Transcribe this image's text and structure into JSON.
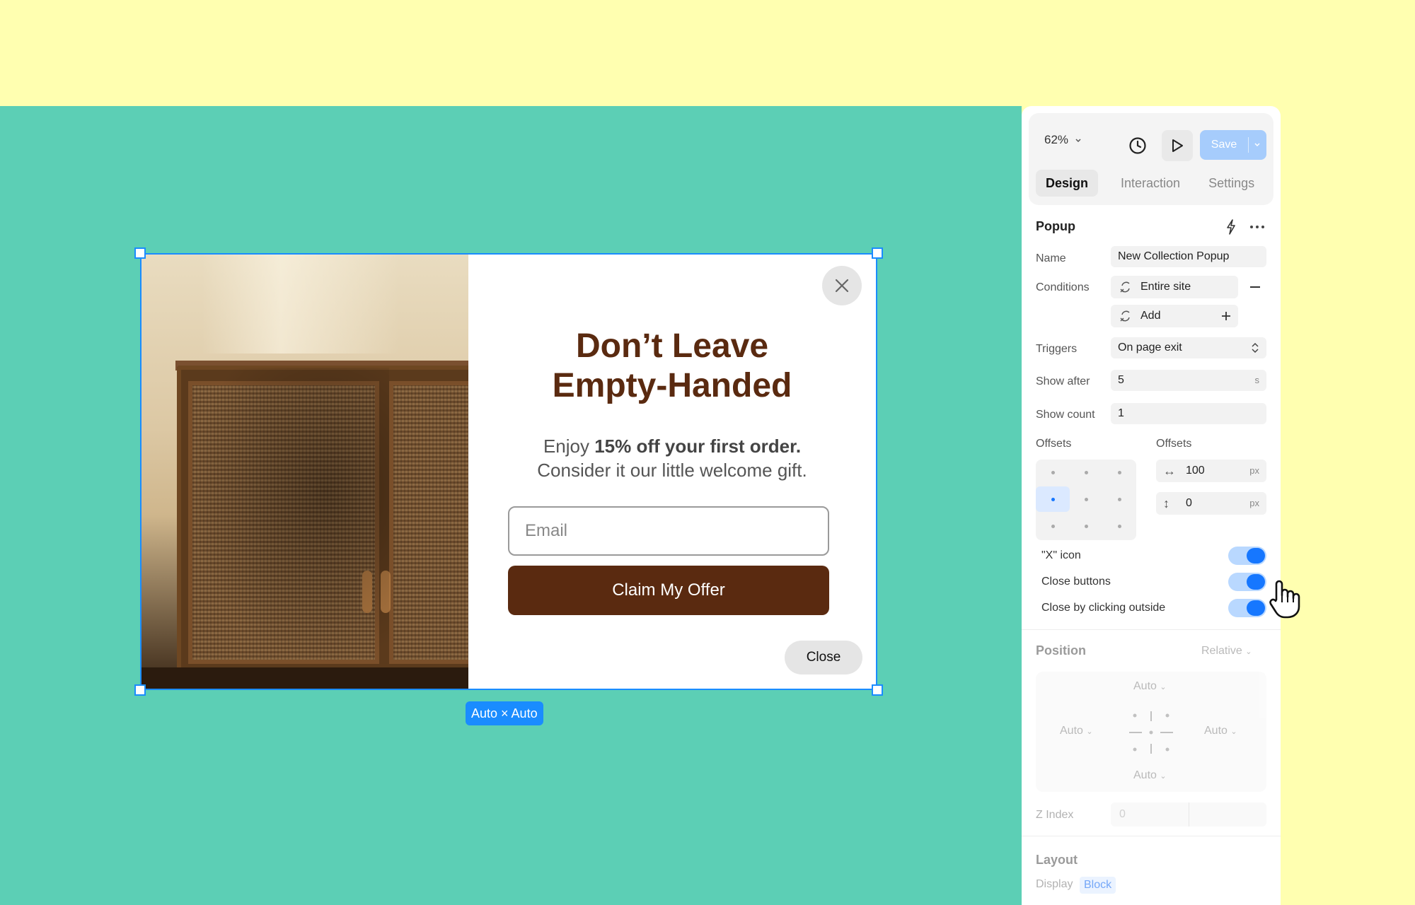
{
  "popup": {
    "title_line1": "Don’t Leave",
    "title_line2": "Empty-Handed",
    "subtitle_pre": "Enjoy ",
    "subtitle_bold": "15% off your first order.",
    "subtitle_line2": "Consider it our little welcome gift.",
    "email_placeholder": "Email",
    "claim_label": "Claim My Offer",
    "close_label": "Close",
    "size_badge": "Auto × Auto"
  },
  "toolbar": {
    "zoom": "62%",
    "save_label": "Save"
  },
  "tabs": [
    "Design",
    "Interaction",
    "Settings"
  ],
  "popup_section": {
    "title": "Popup",
    "name_label": "Name",
    "name_value": "New Collection Popup",
    "conditions_label": "Conditions",
    "condition_1": "Entire site",
    "condition_add": "Add",
    "triggers_label": "Triggers",
    "triggers_value": "On page exit",
    "show_after_label": "Show after",
    "show_after_value": "5",
    "show_after_unit": "s",
    "show_count_label": "Show count",
    "show_count_value": "1",
    "offsets_label_1": "Offsets",
    "offsets_label_2": "Offsets",
    "offset_x": "100",
    "offset_y": "0",
    "offset_unit": "px",
    "toggles": [
      {
        "label": "\"X\" icon",
        "on": true
      },
      {
        "label": "Close buttons",
        "on": true
      },
      {
        "label": "Close by clicking outside",
        "on": true
      }
    ]
  },
  "position_section": {
    "title": "Position",
    "mode": "Relative",
    "top": "Auto",
    "left": "Auto",
    "right": "Auto",
    "bottom": "Auto",
    "z_index_label": "Z Index",
    "z_index_value": "0"
  },
  "layout_section": {
    "title": "Layout",
    "display_label": "Display",
    "display_value": "Block"
  },
  "colors": {
    "canvas": "#5ccfb5",
    "page_bg": "#ffffb0",
    "accent": "#1a8cff",
    "brand_brown": "#5a2a10"
  }
}
